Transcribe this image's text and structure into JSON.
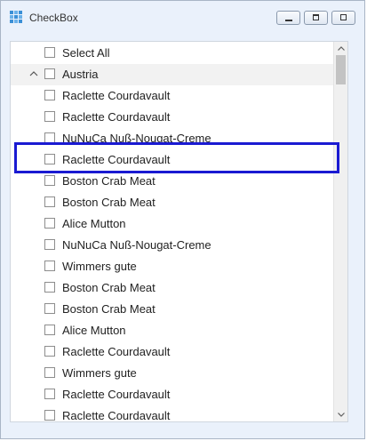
{
  "window": {
    "title": "CheckBox"
  },
  "list": {
    "items": [
      {
        "label": "Select All",
        "group": false
      },
      {
        "label": "Austria",
        "group": true
      },
      {
        "label": "Raclette Courdavault",
        "group": false
      },
      {
        "label": "Raclette Courdavault",
        "group": false
      },
      {
        "label": "NuNuCa Nuß-Nougat-Creme",
        "group": false
      },
      {
        "label": "Raclette Courdavault",
        "group": false
      },
      {
        "label": "Boston Crab Meat",
        "group": false
      },
      {
        "label": "Boston Crab Meat",
        "group": false
      },
      {
        "label": "Alice Mutton",
        "group": false
      },
      {
        "label": "NuNuCa Nuß-Nougat-Creme",
        "group": false
      },
      {
        "label": "Wimmers gute",
        "group": false
      },
      {
        "label": "Boston Crab Meat",
        "group": false
      },
      {
        "label": "Boston Crab Meat",
        "group": false
      },
      {
        "label": "Alice Mutton",
        "group": false
      },
      {
        "label": "Raclette Courdavault",
        "group": false
      },
      {
        "label": "Wimmers gute",
        "group": false
      },
      {
        "label": "Raclette Courdavault",
        "group": false
      },
      {
        "label": "Raclette Courdavault",
        "group": false
      }
    ]
  },
  "colors": {
    "highlight_border": "#1a1ad2",
    "group_row_background": "#f2f2f2",
    "app_icon": "#3a8fd6"
  },
  "icons": {
    "app": "grid-icon",
    "group_toggle": "chevron-up-icon",
    "scroll_up": "chevron-up-icon",
    "scroll_down": "chevron-down-icon"
  }
}
